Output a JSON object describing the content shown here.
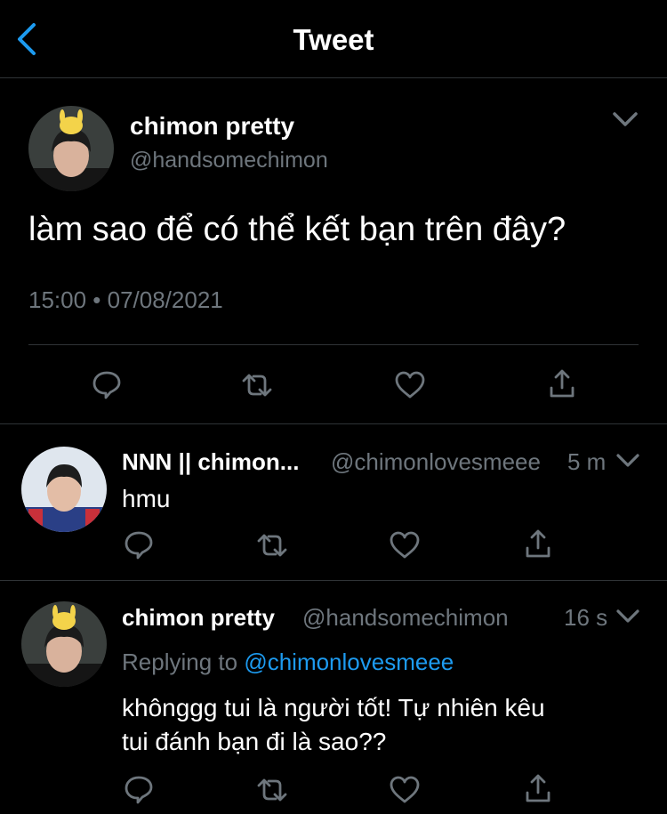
{
  "header": {
    "title": "Tweet"
  },
  "main_tweet": {
    "display_name": "chimon pretty",
    "handle": "@handsomechimon",
    "text": "làm sao để có thể kết bạn trên đây?",
    "timestamp": "15:00 • 07/08/2021"
  },
  "replies": [
    {
      "display_name": "NNN || chimon...",
      "handle": "@chimonlovesmeee",
      "time": "5 m",
      "text": "hmu"
    },
    {
      "display_name": "chimon pretty",
      "handle": "@handsomechimon",
      "time": "16 s",
      "replying_prefix": "Replying to",
      "replying_to": "@chimonlovesmeee",
      "text_line1": "khônggg tui là người tốt! Tự nhiên kêu",
      "text_line2": "tui đánh bạn đi là sao??"
    }
  ],
  "icons": {
    "back": "chevron-left-icon",
    "more": "chevron-down-icon",
    "reply": "reply-icon",
    "retweet": "retweet-icon",
    "like": "heart-icon",
    "share": "share-icon"
  },
  "colors": {
    "background": "#000000",
    "accent": "#1d9bf0",
    "secondary_text": "#6e767d",
    "divider": "#2f3336"
  }
}
